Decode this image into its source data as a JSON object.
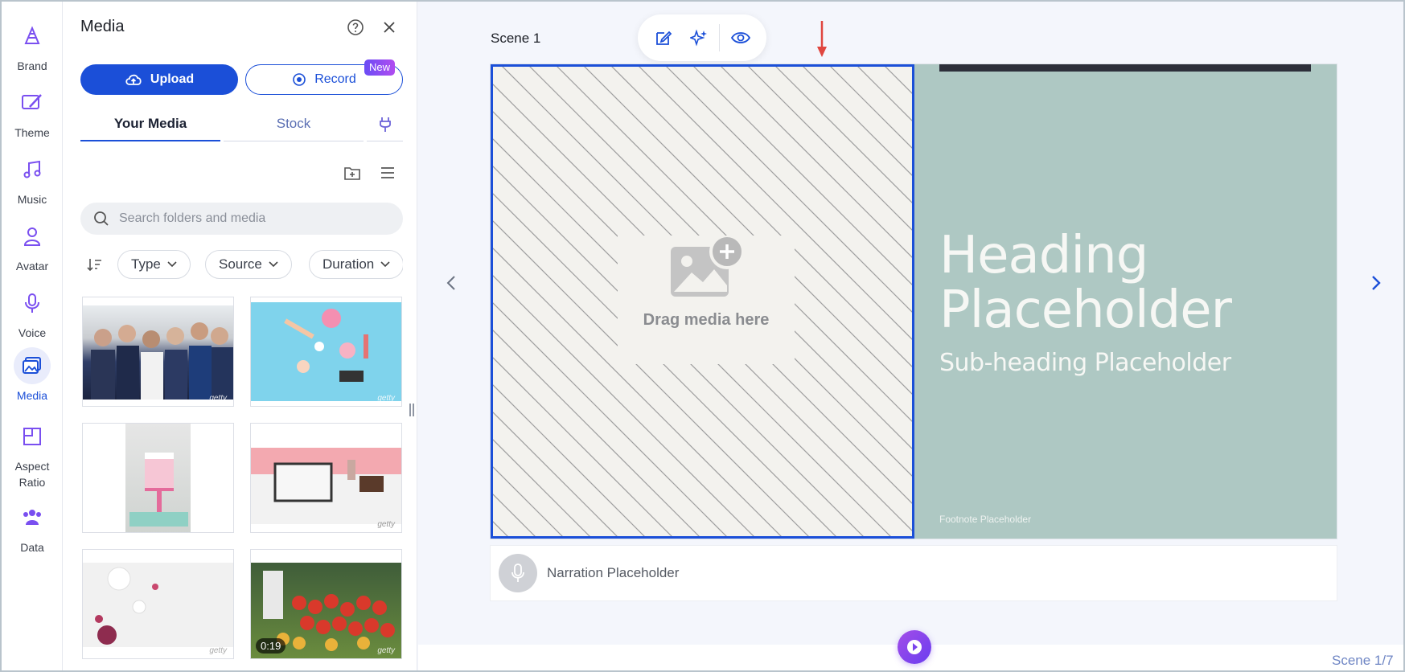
{
  "rail": {
    "items": [
      {
        "label": "Brand",
        "icon": "brand-icon"
      },
      {
        "label": "Theme",
        "icon": "theme-icon"
      },
      {
        "label": "Music",
        "icon": "music-icon"
      },
      {
        "label": "Avatar",
        "icon": "avatar-icon"
      },
      {
        "label": "Voice",
        "icon": "voice-icon"
      },
      {
        "label": "Media",
        "icon": "media-icon",
        "active": true
      },
      {
        "label": "Aspect\nRatio",
        "icon": "aspect-ratio-icon"
      },
      {
        "label": "Data",
        "icon": "data-icon"
      }
    ]
  },
  "panel": {
    "title": "Media",
    "upload_label": "Upload",
    "record_label": "Record",
    "new_badge": "New",
    "tabs": [
      {
        "label": "Your Media",
        "active": true
      },
      {
        "label": "Stock"
      }
    ],
    "search_placeholder": "Search folders and media",
    "filters": [
      {
        "label": "Type"
      },
      {
        "label": "Source"
      },
      {
        "label": "Duration"
      }
    ],
    "thumbnails": [
      {
        "desc": "business-people",
        "watermark": "getty"
      },
      {
        "desc": "cosmetics-blue",
        "watermark": "getty"
      },
      {
        "desc": "cake-stand",
        "watermark": ""
      },
      {
        "desc": "tablet-desk",
        "watermark": "getty"
      },
      {
        "desc": "skincare-flatlay",
        "watermark": "getty"
      },
      {
        "desc": "produce-market",
        "watermark": "getty",
        "duration": "0:19"
      }
    ]
  },
  "canvas": {
    "scene_label": "Scene 1",
    "drop_text": "Drag media here",
    "heading_line1": "Heading",
    "heading_line2": "Placeholder",
    "subheading": "Sub-heading Placeholder",
    "footnote": "Footnote Placeholder",
    "narration": "Narration Placeholder",
    "scene_counter": "Scene 1/7"
  },
  "colors": {
    "accent": "#1b4fd8",
    "slide_bg": "#aec8c3",
    "play_gradient_start": "#a34de8",
    "play_gradient_end": "#6a3df0",
    "arrow": "#e0463f"
  }
}
